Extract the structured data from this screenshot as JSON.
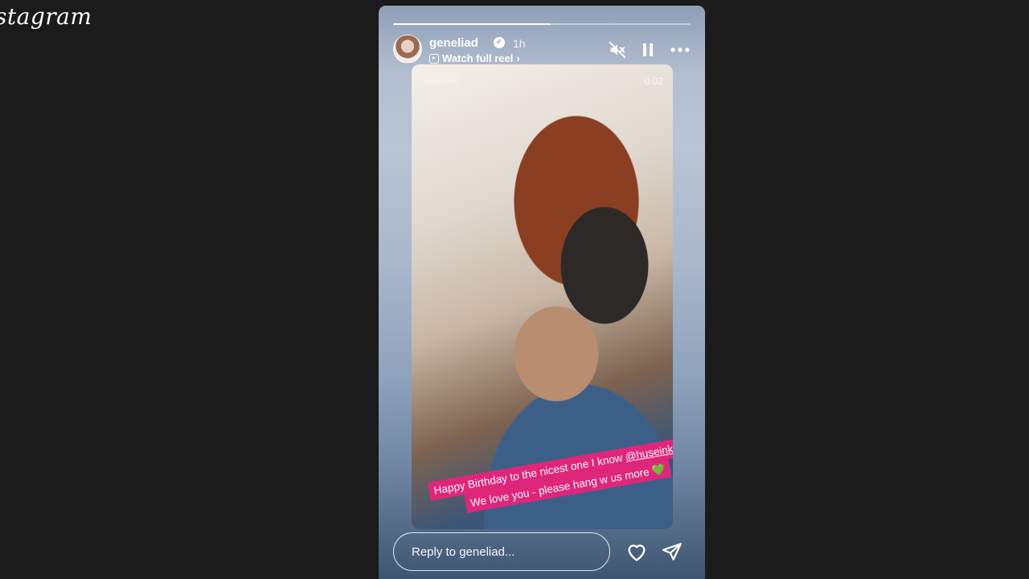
{
  "app": {
    "logo_text": "stagram"
  },
  "story": {
    "progress_fraction": 0.53,
    "username": "geneliad",
    "verified_mark": "✓",
    "time_ago": "1h",
    "watch_full_reel": "Watch full reel",
    "reel_chevron": "›",
    "video_watermark": "huseinkk",
    "video_time": "0:02",
    "caption_line1_text": "Happy Birthday to the nicest one I know ",
    "caption_mention": "@huseinkk",
    "caption_line2_text": "We love you - please hang w us more ",
    "caption_emoji": "💚",
    "reply_placeholder": "Reply to geneliad...",
    "icons": [
      "mute-icon",
      "pause-icon",
      "more-icon",
      "heart-icon",
      "send-icon",
      "reel-icon",
      "verified-icon"
    ],
    "colors": {
      "caption_bg": "#e0267a",
      "page_bg": "#1b1b1b"
    }
  }
}
